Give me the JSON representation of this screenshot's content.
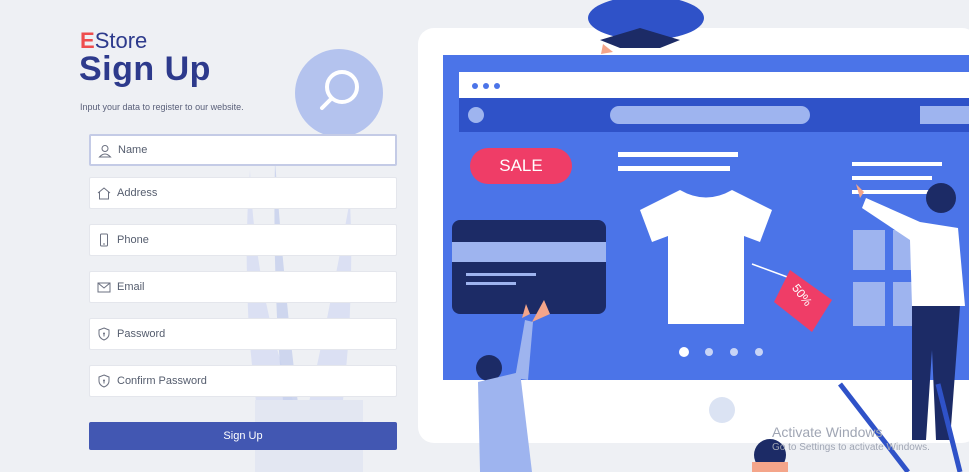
{
  "brand": {
    "e": "E",
    "rest": "Store"
  },
  "page_title": "Sign Up",
  "subtitle": "Input your data to register to our website.",
  "fields": [
    {
      "placeholder": "Name",
      "icon": "user-icon"
    },
    {
      "placeholder": "Address",
      "icon": "home-icon"
    },
    {
      "placeholder": "Phone",
      "icon": "phone-icon"
    },
    {
      "placeholder": "Email",
      "icon": "mail-icon"
    },
    {
      "placeholder": "Password",
      "icon": "shield-icon"
    },
    {
      "placeholder": "Confirm Password",
      "icon": "shield-icon"
    }
  ],
  "submit_label": "Sign Up",
  "illustration": {
    "sale": "SALE",
    "tag": "50%"
  },
  "watermark": {
    "line1": "Activate Windows",
    "line2": "Go to Settings to activate Windows."
  },
  "colors": {
    "primary": "#4257b2",
    "brand_accent": "#ee4d4d",
    "title": "#2d3a8c",
    "screen": "#4b74e8",
    "sale": "#ef3d67"
  }
}
